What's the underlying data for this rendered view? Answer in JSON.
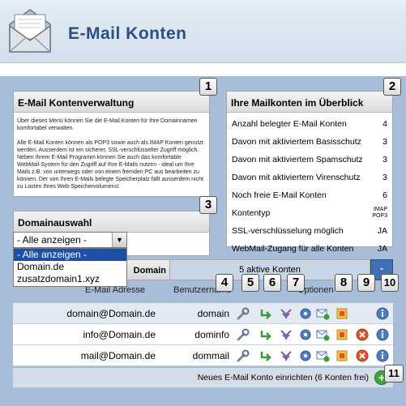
{
  "header": {
    "title": "E-Mail Konten"
  },
  "box1": {
    "badge": "1",
    "title": "E-Mail Kontenverwaltung",
    "paragraphs": [
      "Über dieses Menü können Sie die E-Mail Konten für Ihre Domainnamen komfortabel verwalten.",
      "Alle E-Mail Konten können als POP3 sowie auch als IMAP Konten genutzt werden. Ausserdem ist ein sicherer, SSL-verschlüsselter Zugriff möglich. Neben Ihrem E-Mail Programm können Sie auch das komfortable WebMail-System für den Zugriff auf Ihre E-Mails nutzen - ideal um Ihre Mails z.B. von unterwegs oder von einem fremden PC aus bearbeiten zu können. Der von Ihren E-Mails belegte Speicherplatz fällt ausserdem nicht zu Lasten Ihres Web-Speichervolumens!"
    ]
  },
  "box2": {
    "badge": "2",
    "title": "Ihre Mailkonten im Überblick",
    "rows": [
      {
        "label": "Anzahl belegter E-Mail Konten",
        "value": "4"
      },
      {
        "label": "Davon mit aktiviertem Basisschutz",
        "value": "3"
      },
      {
        "label": "Davon mit aktiviertem Spamschutz",
        "value": "3"
      },
      {
        "label": "Davon mit aktiviertem Virenschutz",
        "value": "3"
      },
      {
        "label": "Noch freie E-Mail Konten",
        "value": "6"
      },
      {
        "label": "Kontentyp",
        "value": "IMAP POP3"
      },
      {
        "label": "SSL-verschlüsselung möglich",
        "value": "JA"
      },
      {
        "label": "WebMail-Zugang für alle Konten",
        "value": "JA"
      }
    ]
  },
  "domain": {
    "badge": "3",
    "title": "Domainauswahl",
    "selected": "- Alle anzeigen -",
    "options": [
      "- Alle anzeigen -",
      "Domain.de",
      "zusatzdomain1.xyz"
    ]
  },
  "table": {
    "header_domain": "Domain",
    "header_count": "5 aktive Konten",
    "toggle": "-",
    "col_email": "E-Mail Adresse",
    "col_user": "Benutzername",
    "col_options": "Optionen",
    "badges": [
      "4",
      "5",
      "6",
      "7",
      "8",
      "9",
      "10",
      "11"
    ],
    "rows": [
      {
        "email": "domain@Domain.de",
        "user": "domain"
      },
      {
        "email": "info@Domain.de",
        "user": "dominfo"
      },
      {
        "email": "mail@Domain.de",
        "user": "dommail"
      }
    ],
    "footer": "Neues E-Mail Konto einrichten (6 Konten frei)",
    "add": "+"
  },
  "colors": {
    "accent": "#2a4f82",
    "panel_bg": "#a8bdd7",
    "highlight": "#1b50a8"
  },
  "icons": [
    "envelope-icon",
    "wrench-icon",
    "forward-icon",
    "filter-icon",
    "gear-icon",
    "mail-add-icon",
    "shield-icon",
    "delete-icon",
    "info-icon",
    "add-icon"
  ]
}
